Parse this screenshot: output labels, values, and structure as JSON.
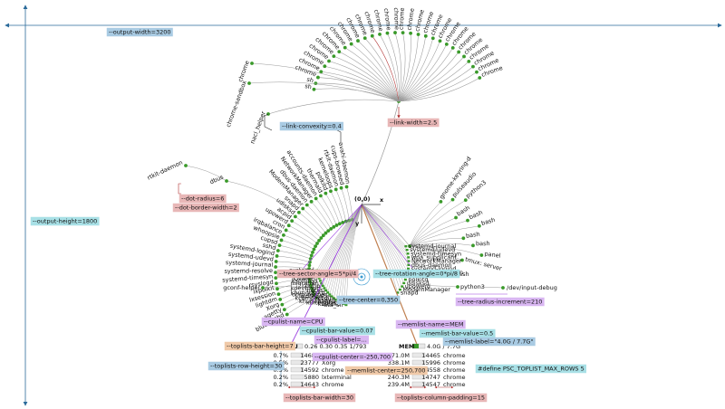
{
  "colors": {
    "tree_line": "#999999",
    "highlight_line": "#b03030",
    "dot": "#3a9a2a",
    "dimension": "#2a6a9a",
    "cpu": "#9b40e0",
    "mem": "#c08050",
    "blue_box": "#a9cbe3",
    "purple_box": "#d9b7f2",
    "red_box": "#e8b7b7",
    "orange_box": "#f0c9a8",
    "cyan_box": "#a8e0e6",
    "text": "#111111"
  },
  "annotations": {
    "output_width": "--output-width=3200",
    "output_height": "--output-height=1800",
    "link_convexity": "--link-convexity=0.4",
    "link_width": "--link-width=2.5",
    "dot_radius": "--dot-radius=6",
    "dot_border_width": "--dot-border-width=2",
    "tree_sector_angle": "--tree-sector-angle=5*pi/4",
    "tree_rotation_angle": "--tree-rotation-angle=0*pi/8",
    "tree_radius_increment": "--tree-radius-increment=210",
    "tree_center": "--tree-center=0,350",
    "cpulist_name": "--cpulist-name=CPU",
    "cpulist_bar_value": "--cpulist-bar-value=0.07",
    "cpulist_label": "--cpulist-label=...",
    "cpulist_center": "--cpulist-center=-250,700",
    "memlist_name": "--memlist-name=MEM",
    "memlist_bar_value": "--memlist-bar-value=0.5",
    "memlist_label": "--memlist-label=\"4.0G / 7.7G\"",
    "memlist_center": "--memlist-center=250,700",
    "toplists_bar_height": "--toplists-bar-height=7",
    "toplists_row_height": "--toplists-row-height=30",
    "toplists_bar_width": "--toplists-bar-width=30",
    "toplists_column_padding": "--toplists-column-padding=15",
    "define_rows": "#define PSC_TOPLIST_MAX_ROWS 5"
  },
  "axes": {
    "origin": "(0,0)",
    "x": "x",
    "y": "y"
  },
  "chrome_branch": [
    "sh",
    "sh",
    "chrome",
    "chrome",
    "chrome",
    "chrome",
    "chrome",
    "chrome",
    "chrome",
    "chrome",
    "chrome",
    "chrome",
    "chrome",
    "chrome",
    "chrome",
    "chrome",
    "chrome",
    "chrome",
    "chrome",
    "chrome",
    "chrome",
    "chrome",
    "chrome",
    "chrome",
    "chrome",
    "chrome",
    "chrome",
    "chrome",
    "chrome",
    "chrome"
  ],
  "chrome_extra": [
    "nacl_helper",
    "chrome-sandbox",
    "chrome"
  ],
  "left_fan": [
    "avahi-daemon",
    "cups-browsed",
    "rtkit-daemon",
    "kerneloops",
    "polkitd",
    "thermald",
    "accounts-daemon",
    "NetworkManager",
    "dbus-daemon",
    "ModemManager",
    "snapd",
    "udisksd",
    "acpid",
    "upowerd",
    "cron",
    "irqbalance",
    "whoopsie",
    "cupsd",
    "sshd",
    "systemd-logind",
    "systemd-udevd",
    "systemd-journal",
    "systemd-resolve",
    "systemd-timesyn",
    "rsyslogd",
    "lxpolkit",
    "lxsession",
    "lightdm",
    "Xorg",
    "agetty",
    "bluetoothd"
  ],
  "tiny_left": [
    "rtkit-daemon",
    "dbus"
  ],
  "inner_left": [
    "systemd",
    "kthreadd",
    "rcu_gp",
    "kworker",
    "ksoftirqd",
    "migration",
    "cpuhp",
    "kdevtmpfs",
    "netns",
    "khungtaskd",
    "oom_reaper",
    "writeback",
    "kcompactd0",
    "ksmd",
    "khugepaged",
    "kintegrityd",
    "kblockd",
    "ata_sff"
  ],
  "gnome_helper": "gconf-helper",
  "right_fan": [
    "gnome-keyring-d",
    "pulseaudio",
    "python3",
    "bash",
    "bash",
    "bash",
    "bash",
    "bash",
    "panel",
    "tmux: server"
  ],
  "inner_right": [
    "systemd-journal",
    "systemd-udevd",
    "systemd-timesyn",
    "wpa_supplicant",
    "NetworkManager",
    "dbus-daemon",
    "systemd-logind",
    "accounts-daemon",
    "avahi-daemon",
    "polkitd",
    "udisksd",
    "upowerd",
    "ModemManager",
    "snapd"
  ],
  "python_chain": [
    "bash",
    "python3",
    "/dev/input-debug"
  ],
  "cpu_toplist": {
    "header": "CPU",
    "scale": "0.26 0.30 0.35 1/793",
    "rows": [
      {
        "pct": "0.7%",
        "pid": "14685",
        "name": "chrome"
      },
      {
        "pct": "0.5%",
        "pid": "23777",
        "name": "Xorg"
      },
      {
        "pct": "0.5%",
        "pid": "14592",
        "name": "chrome"
      },
      {
        "pct": "0.2%",
        "pid": "5880",
        "name": "lxterminal"
      },
      {
        "pct": "0.2%",
        "pid": "14643",
        "name": "chrome"
      }
    ]
  },
  "mem_toplist": {
    "header": "MEM",
    "scale": "4.0G / 7.7G",
    "rows": [
      {
        "pct": "571.0M",
        "pid": "14465",
        "name": "chrome"
      },
      {
        "pct": "338.1M",
        "pid": "15996",
        "name": "chrome"
      },
      {
        "pct": "265.2M",
        "pid": "14558",
        "name": "chrome"
      },
      {
        "pct": "240.3M",
        "pid": "14747",
        "name": "chrome"
      },
      {
        "pct": "239.4M",
        "pid": "14547",
        "name": "chrome"
      }
    ]
  }
}
